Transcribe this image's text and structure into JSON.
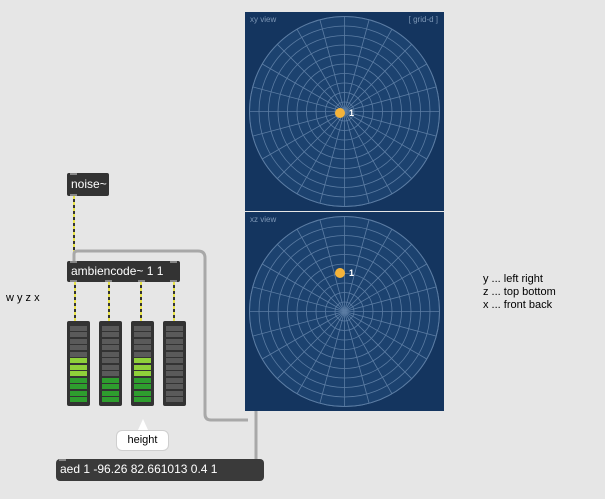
{
  "objects": {
    "noise": "noise~",
    "ambiencode": "ambiencode~ 1 1",
    "message": "aed 1 -96.26 82.661013 0.4 1"
  },
  "comments": {
    "channels": "w y z x",
    "bubble": "height",
    "axis_legend": [
      "y ... left right",
      "z ... top bottom",
      "x ... front back"
    ]
  },
  "panel": {
    "xy_title": "xy view",
    "mode": "[ grid-d ]",
    "xz_title": "xz view",
    "source_label": "1",
    "background": "#14355f",
    "grid_color": "#5b7ca3",
    "source_color": "#f4b33a"
  },
  "meters": [
    {
      "channel": "w",
      "level": 0.6
    },
    {
      "channel": "y",
      "level": 0.35
    },
    {
      "channel": "z",
      "level": 0.6
    },
    {
      "channel": "x",
      "level": 0.0
    }
  ],
  "meter_colors": {
    "off": "#5a5a5a",
    "green": "#2e9e2e",
    "light_green": "#8fd13a",
    "yellow": "#e2d63a",
    "orange": "#f08a24"
  }
}
